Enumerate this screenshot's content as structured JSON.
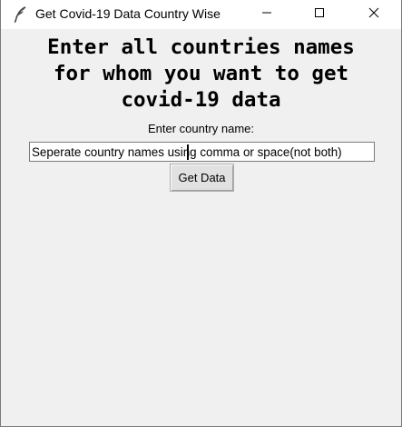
{
  "window": {
    "title": "Get Covid-19 Data Country Wise"
  },
  "icons": {
    "app": "feather-icon",
    "minimize": "minimize-icon",
    "maximize": "maximize-icon",
    "close": "close-icon"
  },
  "main": {
    "heading_lines": [
      "Enter all countries names",
      "for whom you want to get",
      "covid-19 data"
    ],
    "entry_label": "Enter country name:",
    "entry_value": "Seperate country names using comma or space(not both)",
    "button_label": "Get Data"
  }
}
